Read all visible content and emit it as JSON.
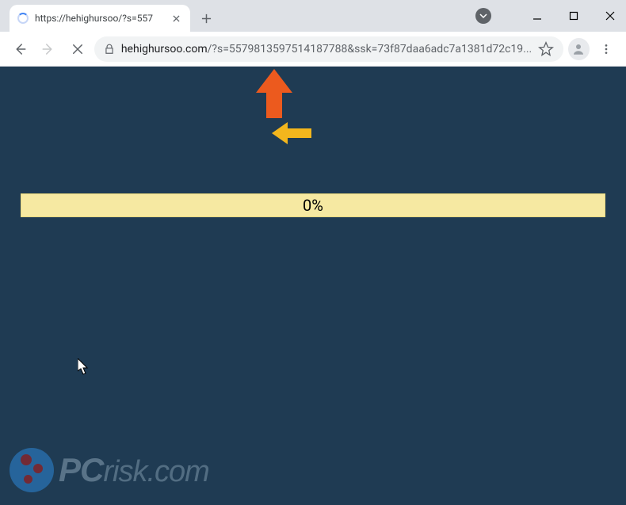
{
  "window": {
    "minimize_tooltip": "Minimize",
    "maximize_tooltip": "Maximize",
    "close_tooltip": "Close"
  },
  "tab": {
    "title": "https://hehighursoo/?s=557",
    "close_tooltip": "Close tab",
    "new_tab_tooltip": "New tab"
  },
  "toolbar": {
    "back_tooltip": "Back",
    "forward_tooltip": "Forward",
    "stop_tooltip": "Stop",
    "url_domain": "hehighursoo.com",
    "url_path": "/?s=5579813597514187788&ssk=73f87daa6adc7a1381d72c19...",
    "bookmark_tooltip": "Bookmark this tab",
    "profile_tooltip": "You",
    "menu_tooltip": "Customize and control"
  },
  "page": {
    "progress_value": 0,
    "progress_label": "0%"
  },
  "watermark": {
    "brand_prefix": "PC",
    "brand_suffix": "risk",
    "tld": ".com"
  }
}
